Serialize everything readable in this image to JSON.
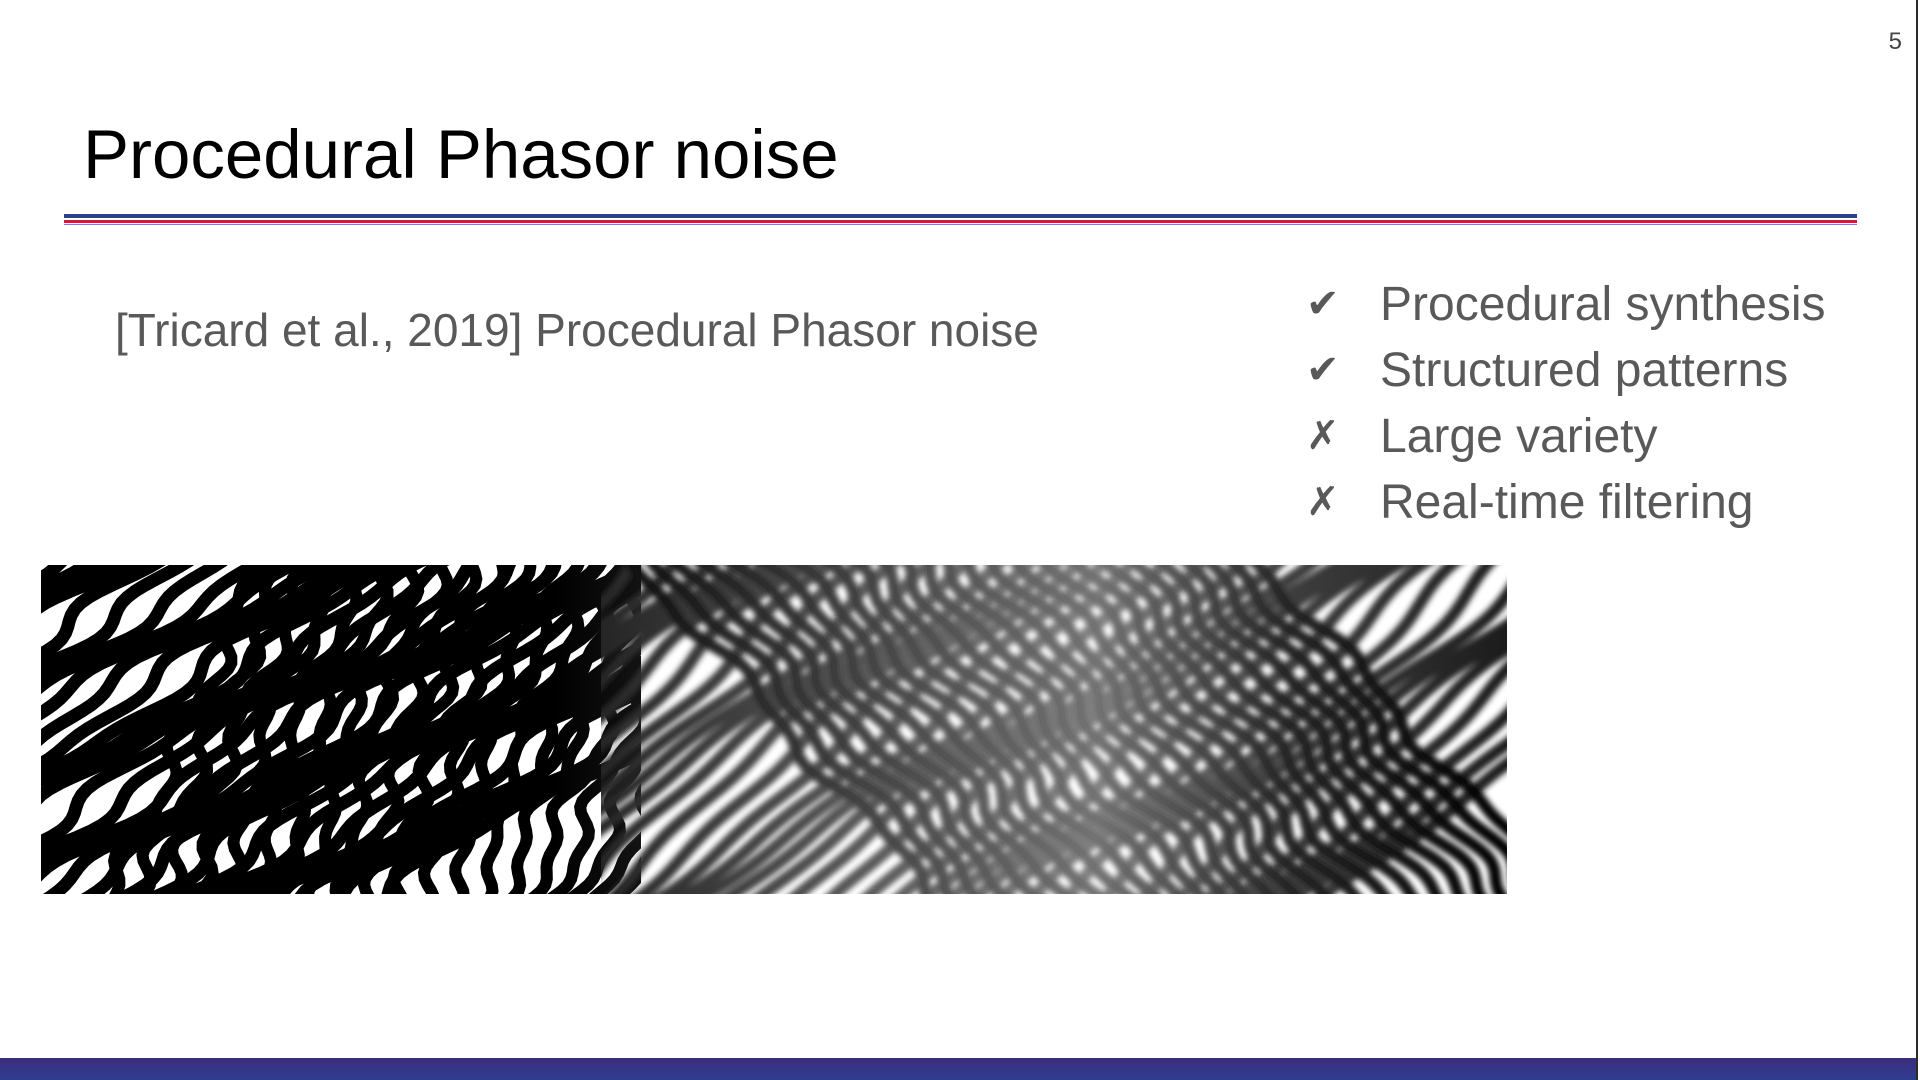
{
  "slide": {
    "page_number": "5",
    "title": "Procedural Phasor noise",
    "citation": "[Tricard et al., 2019] Procedural Phasor noise",
    "features": [
      {
        "mark": "✔",
        "status": "supported",
        "label": "Procedural synthesis"
      },
      {
        "mark": "✔",
        "status": "supported",
        "label": "Structured patterns"
      },
      {
        "mark": "✗",
        "status": "not-supported",
        "label": "Large variety"
      },
      {
        "mark": "✗",
        "status": "not-supported",
        "label": "Real-time filtering"
      }
    ]
  },
  "figure": {
    "icon": "phasor-noise-pattern",
    "description_style": "wavy black and white stripes, sharp binary on the left transitioning to smooth sinusoidal grey on the right"
  },
  "colors": {
    "rule_blue": "#2e3f8f",
    "rule_red": "#c0223c",
    "footer_bar": "#33368a",
    "body_text": "#595959",
    "title_text": "#000000"
  }
}
